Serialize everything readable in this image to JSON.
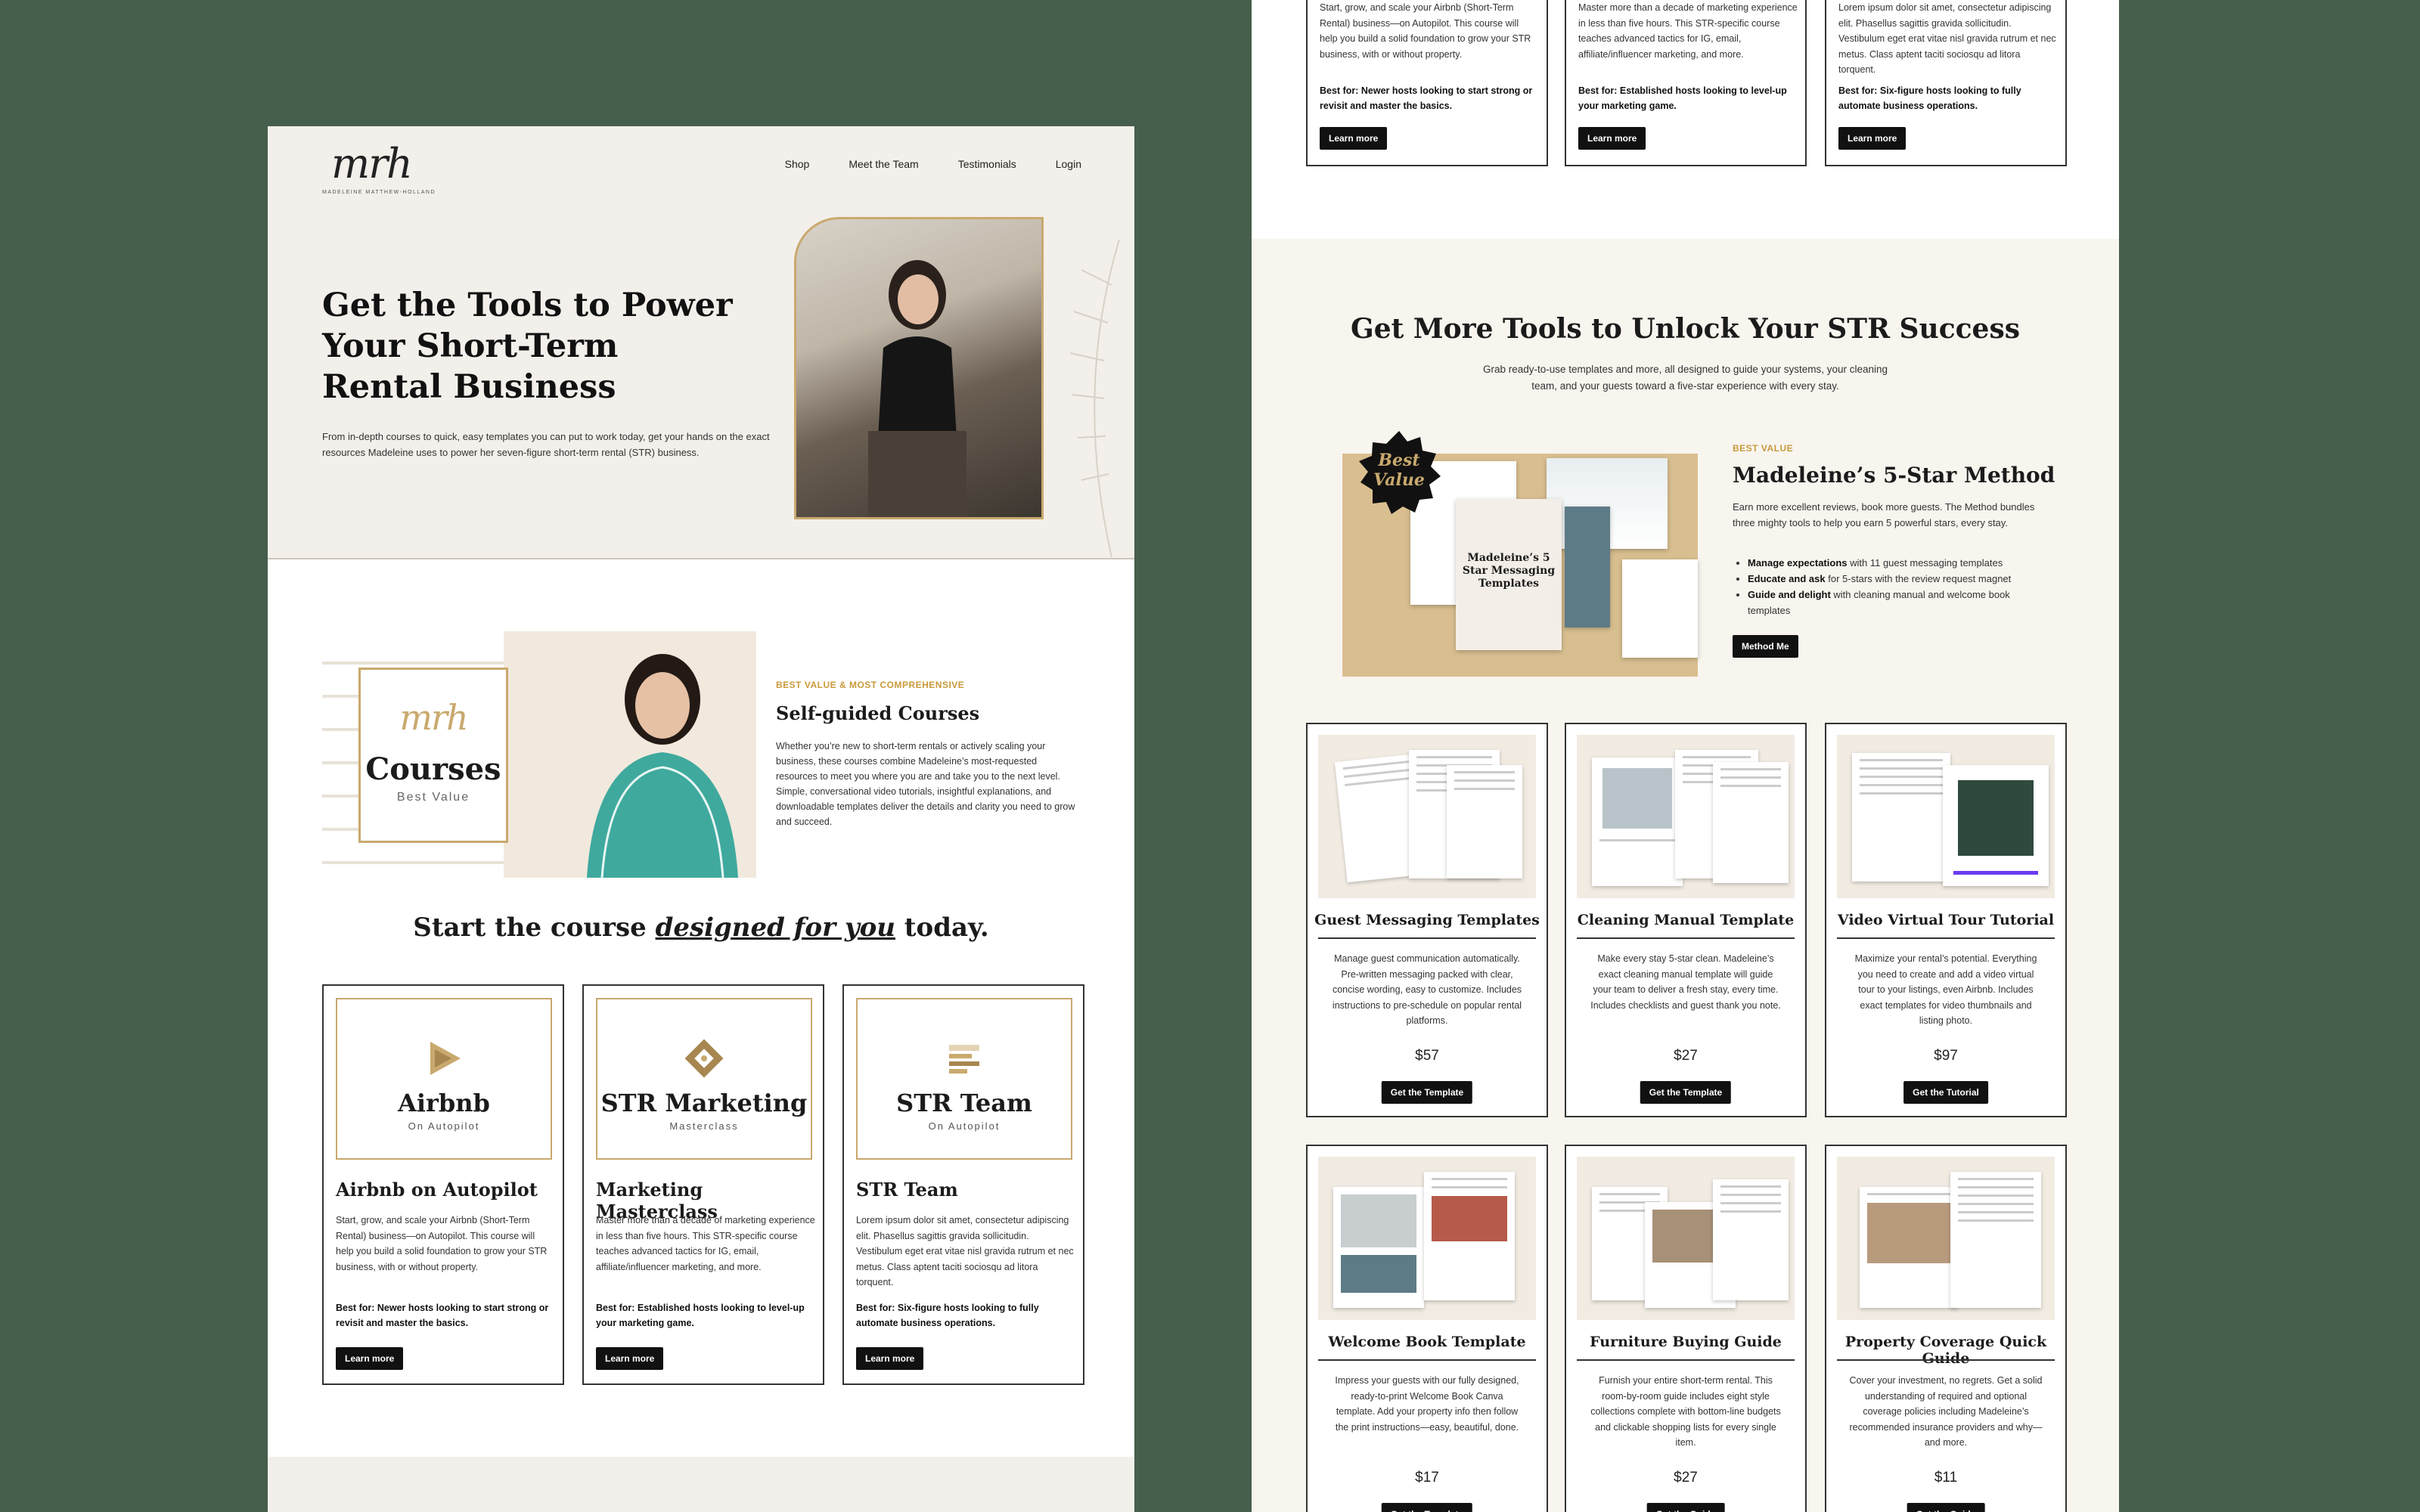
{
  "left": {
    "logo": {
      "script": "mrh",
      "subtitle": "MADELEINE MATTHEW-HOLLAND"
    },
    "nav": [
      "Shop",
      "Meet the Team",
      "Testimonials",
      "Login"
    ],
    "hero": {
      "title": "Get the Tools to Power Your Short-Term Rental Business",
      "description": "From in-depth courses to quick, easy templates you can put to work today, get your hands on the exact resources Madeleine uses to power her seven-figure short-term rental (STR) business."
    },
    "courses_banner": {
      "script": "mrh",
      "title": "Courses",
      "subtitle": "Best Value"
    },
    "self_guided": {
      "eyebrow": "BEST VALUE & MOST COMPREHENSIVE",
      "title": "Self-guided Courses",
      "description": "Whether you’re new to short-term rentals or actively scaling your business, these courses combine Madeleine’s most-requested resources to meet you where you are and take you to the next level. Simple, conversational video tutorials, insightful explanations, and downloadable templates deliver the details and clarity you need to grow and succeed."
    },
    "start": {
      "before": "Start the course ",
      "emphasis": "designed for you",
      "after": " today."
    },
    "courses": [
      {
        "card_name": "Airbnb",
        "card_sub": "On Autopilot",
        "title": "Airbnb on Autopilot",
        "description": "Start, grow, and scale your Airbnb (Short-Term Rental) business—on Autopilot. This course will help you build a solid foundation to grow your STR business, with or without property.",
        "best_for": "Best for: Newer hosts looking to start strong or revisit and master the basics.",
        "button": "Learn more"
      },
      {
        "card_name": "STR Marketing",
        "card_sub": "Masterclass",
        "title": "Marketing Masterclass",
        "description": "Master more than a decade of marketing experience in less than five hours. This STR-specific course teaches advanced tactics for IG, email, affiliate/influencer marketing, and more.",
        "best_for": "Best for: Established hosts looking to level-up your marketing game.",
        "button": "Learn more"
      },
      {
        "card_name": "STR Team",
        "card_sub": "On Autopilot",
        "title": "STR Team",
        "description": "Lorem ipsum dolor sit amet, consectetur adipiscing elit. Phasellus sagittis gravida sollicitudin. Vestibulum eget erat vitae nisl gravida rutrum et nec metus. Class aptent taciti sociosqu ad litora torquent.",
        "best_for": "Best for: Six-figure hosts looking to fully automate business operations.",
        "button": "Learn more"
      }
    ]
  },
  "right": {
    "top_cards": [
      {
        "description": "Start, grow, and scale your Airbnb (Short-Term Rental) business—on Autopilot. This course will help you build a solid foundation to grow your STR business, with or without property.",
        "best_for": "Best for: Newer hosts looking to start strong or revisit and master the basics.",
        "button": "Learn more"
      },
      {
        "description": "Master more than a decade of marketing experience in less than five hours. This STR-specific course teaches advanced tactics for IG, email, affiliate/influencer marketing, and more.",
        "best_for": "Best for: Established hosts looking to level-up your marketing game.",
        "button": "Learn more"
      },
      {
        "description": "Lorem ipsum dolor sit amet, consectetur adipiscing elit. Phasellus sagittis gravida sollicitudin. Vestibulum eget erat vitae nisl gravida rutrum et nec metus. Class aptent taciti sociosqu ad litora torquent.",
        "best_for": "Best for: Six-figure hosts looking to fully automate business operations.",
        "button": "Learn more"
      }
    ],
    "more": {
      "title": "Get More Tools to Unlock Your STR Success",
      "description": "Grab ready-to-use templates and more, all designed to guide your systems, your cleaning team, and your guests toward a five-star experience with every stay."
    },
    "method": {
      "badge": "Best Value",
      "cover_title": "Madeleine’s 5 Star Messaging Templates",
      "eyebrow": "BEST VALUE",
      "title": "Madeleine’s 5-Star Method",
      "description": "Earn more excellent reviews, book more guests. The Method bundles three mighty tools to help you earn 5 powerful stars, every stay.",
      "bullets": [
        {
          "bold": "Manage expectations",
          "rest": " with 11 guest messaging templates"
        },
        {
          "bold": "Educate and ask",
          "rest": " for 5-stars with the review request magnet"
        },
        {
          "bold": "Guide and delight",
          "rest": " with cleaning manual and welcome book templates"
        }
      ],
      "button": "Method Me"
    },
    "templates": [
      {
        "title": "Guest Messaging Templates",
        "description": "Manage guest communication automatically. Pre-written messaging packed with clear, concise wording, easy to customize. Includes instructions to pre-schedule on popular rental platforms.",
        "price": "$57",
        "button": "Get the Template"
      },
      {
        "title": "Cleaning Manual Template",
        "description": "Make every stay 5-star clean. Madeleine’s exact cleaning manual template will guide your team to deliver a fresh stay, every time. Includes checklists and guest thank you note.",
        "price": "$27",
        "button": "Get the Template"
      },
      {
        "title": "Video Virtual Tour Tutorial",
        "description": "Maximize your rental’s potential. Everything you need to create and add a video virtual tour to your listings, even Airbnb. Includes exact templates for video thumbnails and listing photo.",
        "price": "$97",
        "button": "Get the Tutorial"
      },
      {
        "title": "Welcome Book Template",
        "description": "Impress your guests with our fully designed, ready-to-print Welcome Book Canva template. Add your property info then follow the print instructions—easy, beautiful, done.",
        "price": "$17",
        "button": "Get the Template"
      },
      {
        "title": "Furniture Buying Guide",
        "description": "Furnish your entire short-term rental. This room-by-room guide includes eight style collections complete with bottom-line budgets and clickable shopping lists for every single item.",
        "price": "$27",
        "button": "Get the Guide"
      },
      {
        "title": "Property Coverage Quick Guide",
        "description": "Cover your investment, no regrets. Get a solid understanding of required and optional coverage policies including Madeleine’s recommended insurance providers and why—and more.",
        "price": "$11",
        "button": "Get the Guide"
      }
    ]
  },
  "colors": {
    "background": "#465e4c",
    "accent": "#c9a96e",
    "cream": "#f3efea",
    "button": "#111111"
  }
}
